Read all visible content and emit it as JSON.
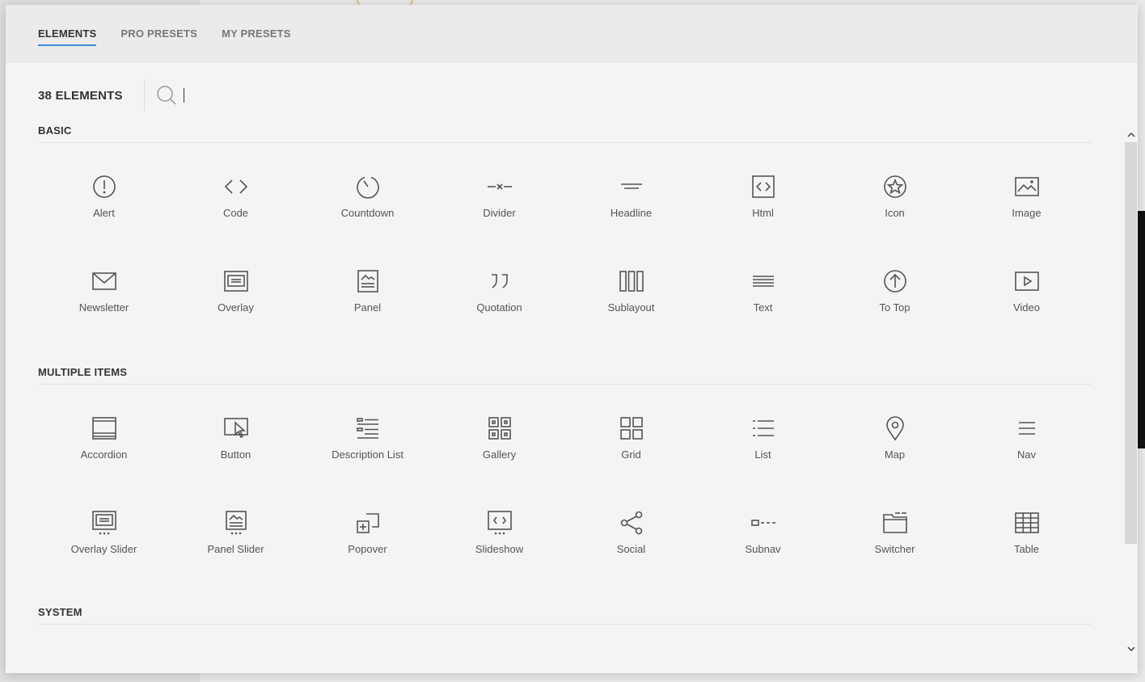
{
  "tabs": [
    {
      "label": "ELEMENTS",
      "active": true
    },
    {
      "label": "PRO PRESETS",
      "active": false
    },
    {
      "label": "MY PRESETS",
      "active": false
    }
  ],
  "toolbar": {
    "count_label": "38 ELEMENTS",
    "search_value": ""
  },
  "sections": {
    "basic": {
      "title": "BASIC"
    },
    "multiple": {
      "title": "MULTIPLE ITEMS"
    },
    "system": {
      "title": "SYSTEM"
    }
  },
  "basic_items": [
    {
      "label": "Alert",
      "icon": "alert-icon"
    },
    {
      "label": "Code",
      "icon": "code-icon"
    },
    {
      "label": "Countdown",
      "icon": "countdown-icon"
    },
    {
      "label": "Divider",
      "icon": "divider-icon"
    },
    {
      "label": "Headline",
      "icon": "headline-icon"
    },
    {
      "label": "Html",
      "icon": "html-icon"
    },
    {
      "label": "Icon",
      "icon": "star-icon"
    },
    {
      "label": "Image",
      "icon": "image-icon"
    },
    {
      "label": "Newsletter",
      "icon": "mail-icon"
    },
    {
      "label": "Overlay",
      "icon": "overlay-icon"
    },
    {
      "label": "Panel",
      "icon": "panel-icon"
    },
    {
      "label": "Quotation",
      "icon": "quote-icon"
    },
    {
      "label": "Sublayout",
      "icon": "columns-icon"
    },
    {
      "label": "Text",
      "icon": "text-icon"
    },
    {
      "label": "To Top",
      "icon": "arrow-up-circle-icon"
    },
    {
      "label": "Video",
      "icon": "video-icon"
    }
  ],
  "multiple_items": [
    {
      "label": "Accordion",
      "icon": "accordion-icon"
    },
    {
      "label": "Button",
      "icon": "cursor-button-icon"
    },
    {
      "label": "Description List",
      "icon": "description-list-icon"
    },
    {
      "label": "Gallery",
      "icon": "gallery-icon"
    },
    {
      "label": "Grid",
      "icon": "grid-icon"
    },
    {
      "label": "List",
      "icon": "list-icon"
    },
    {
      "label": "Map",
      "icon": "map-pin-icon"
    },
    {
      "label": "Nav",
      "icon": "nav-icon"
    },
    {
      "label": "Overlay Slider",
      "icon": "overlay-slider-icon"
    },
    {
      "label": "Panel Slider",
      "icon": "panel-slider-icon"
    },
    {
      "label": "Popover",
      "icon": "popover-icon"
    },
    {
      "label": "Slideshow",
      "icon": "slideshow-icon"
    },
    {
      "label": "Social",
      "icon": "share-icon"
    },
    {
      "label": "Subnav",
      "icon": "subnav-icon"
    },
    {
      "label": "Switcher",
      "icon": "switcher-icon"
    },
    {
      "label": "Table",
      "icon": "table-icon"
    }
  ],
  "colors": {
    "accent": "#3e8dd6",
    "icon": "#555555"
  }
}
